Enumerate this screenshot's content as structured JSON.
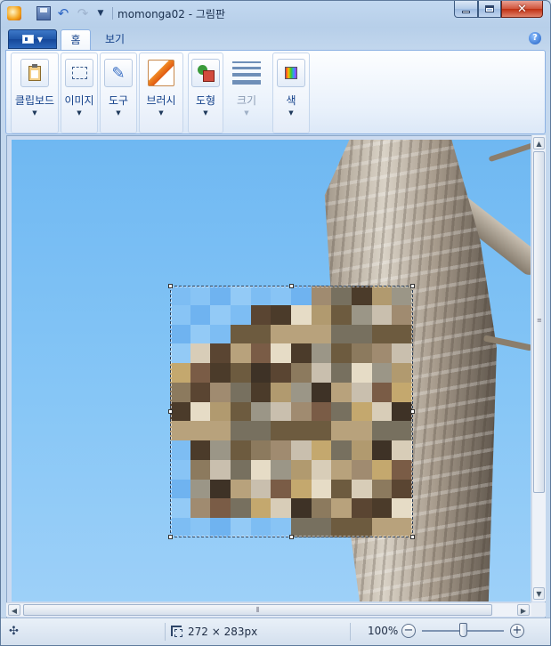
{
  "window": {
    "title": "momonga02 - 그림판"
  },
  "tabs": {
    "home": "홈",
    "view": "보기"
  },
  "ribbon": {
    "groups": [
      {
        "label": "클립보드",
        "icon": "clipboard-icon"
      },
      {
        "label": "이미지",
        "icon": "select-icon"
      },
      {
        "label": "도구",
        "icon": "tools-icon"
      },
      {
        "label": "브러시",
        "icon": "brush-icon"
      },
      {
        "label": "도형",
        "icon": "shapes-icon"
      },
      {
        "label": "크기",
        "icon": "size-icon",
        "disabled": true
      },
      {
        "label": "색",
        "icon": "color-icon"
      }
    ]
  },
  "canvas": {
    "image_name": "momonga02",
    "selection": {
      "width": 272,
      "height": 283
    }
  },
  "status": {
    "selection_size": "272 × 283px",
    "zoom": "100%",
    "zoom_slider_value": 0.5
  },
  "colors": {
    "ribbon_text": "#15428b",
    "sky": "#86c6f6",
    "selection_border": "#2b3f58"
  }
}
